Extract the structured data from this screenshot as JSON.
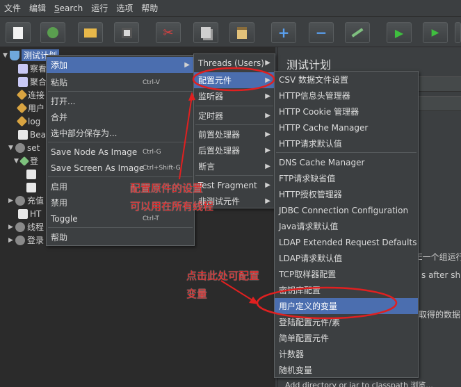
{
  "menubar": [
    "文件",
    "编辑",
    "Search",
    "运行",
    "选项",
    "帮助"
  ],
  "toolbar_icons": [
    "new-icon",
    "templates-icon",
    "open-icon",
    "save-icon",
    "cut-icon",
    "copy-icon",
    "paste-icon",
    "expand-icon",
    "collapse-icon",
    "toggle-icon",
    "start-icon",
    "start-no-pause-icon",
    "stop-icon"
  ],
  "tree": {
    "root": "测试计划",
    "rows": [
      "察看",
      "聚合",
      "连接",
      "用户",
      "log",
      "Bea",
      "set",
      "登",
      "充值",
      "HT",
      "线程",
      "登录"
    ]
  },
  "context_menu": {
    "items": [
      {
        "label": "添加",
        "shortcut": "",
        "submenu": true
      },
      {
        "label": "粘贴",
        "shortcut": "Ctrl-V",
        "submenu": false
      },
      {
        "label": "打开...",
        "shortcut": "",
        "submenu": false
      },
      {
        "label": "合并",
        "shortcut": "",
        "submenu": false
      },
      {
        "label": "选中部分保存为...",
        "shortcut": "",
        "submenu": false
      },
      {
        "label": "Save Node As Image",
        "shortcut": "Ctrl-G",
        "submenu": false
      },
      {
        "label": "Save Screen As Image",
        "shortcut": "Ctrl+Shift-G",
        "submenu": false
      },
      {
        "label": "启用",
        "shortcut": "",
        "submenu": false
      },
      {
        "label": "禁用",
        "shortcut": "",
        "submenu": false
      },
      {
        "label": "Toggle",
        "shortcut": "Ctrl-T",
        "submenu": false
      },
      {
        "label": "帮助",
        "shortcut": "",
        "submenu": false
      }
    ]
  },
  "add_submenu": {
    "items": [
      "Threads (Users)",
      "配置元件",
      "监听器",
      "定时器",
      "前置处理器",
      "后置处理器",
      "断言",
      "Test Fragment",
      "非测试元件"
    ]
  },
  "config_submenu": {
    "items": [
      "CSV 数据文件设置",
      "HTTP信息头管理器",
      "HTTP Cookie 管理器",
      "HTTP Cache Manager",
      "HTTP请求默认值",
      "DNS Cache Manager",
      "FTP请求缺省值",
      "HTTP授权管理器",
      "JDBC Connection Configuration",
      "Java请求默认值",
      "LDAP Extended Request Defaults",
      "LDAP请求默认值",
      "TCP取样器配置",
      "密钥库配置",
      "用户定义的变量",
      "登陆配置元件/素",
      "简单配置元件",
      "计数器",
      "随机变量"
    ]
  },
  "right_panel": {
    "title": "测试计划",
    "text1": "E一个组运行",
    "text2": "s after shut",
    "text3": "取得的数据",
    "bottom": "Add directory or jar to classpath    浏览..."
  },
  "annotations": {
    "note1_line1": "配置原件的设置",
    "note1_line2": "可以用在所有线程",
    "note2_line1": "点击此处可配置",
    "note2_line2": "变量"
  },
  "colors": {
    "highlight": "#4b6eaf",
    "annotation": "#e02020",
    "background": "#3c3f41"
  }
}
